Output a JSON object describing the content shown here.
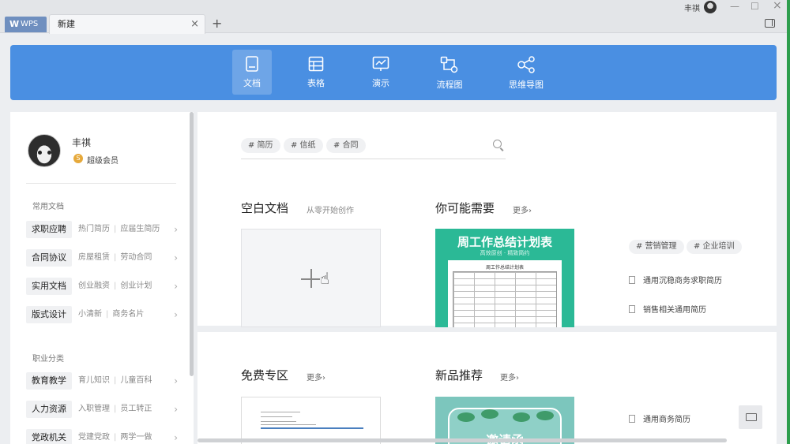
{
  "titlebar": {
    "app_tab": "WPS",
    "active_tab": "新建",
    "tab_close": "×",
    "add_tab": "+",
    "user_name": "丰祺",
    "minimize": "—",
    "maximize": "☐",
    "close": "×"
  },
  "categories": [
    {
      "label": "文档",
      "icon": "document-icon",
      "active": true
    },
    {
      "label": "表格",
      "icon": "spreadsheet-icon",
      "active": false
    },
    {
      "label": "演示",
      "icon": "presentation-icon",
      "active": false
    },
    {
      "label": "流程图",
      "icon": "flowchart-icon",
      "active": false
    },
    {
      "label": "思维导图",
      "icon": "mindmap-icon",
      "active": false
    }
  ],
  "sidebar": {
    "user_name": "丰祺",
    "vip_badge": "S",
    "vip_label": "超级会员",
    "section_common": "常用文档",
    "common_items": [
      {
        "tag": "求职应聘",
        "sub1": "热门简历",
        "sub2": "应届生简历"
      },
      {
        "tag": "合同协议",
        "sub1": "房屋租赁",
        "sub2": "劳动合同"
      },
      {
        "tag": "实用文档",
        "sub1": "创业融资",
        "sub2": "创业计划"
      },
      {
        "tag": "版式设计",
        "sub1": "小清新",
        "sub2": "商务名片"
      }
    ],
    "section_career": "职业分类",
    "career_items": [
      {
        "tag": "教育教学",
        "sub1": "育儿知识",
        "sub2": "儿童百科"
      },
      {
        "tag": "人力资源",
        "sub1": "入职管理",
        "sub2": "员工转正"
      },
      {
        "tag": "党政机关",
        "sub1": "党建党政",
        "sub2": "两学一做"
      }
    ],
    "separator": "|",
    "arrow": "›"
  },
  "search": {
    "tags": [
      "# 简历",
      "# 信纸",
      "# 合同"
    ]
  },
  "blank": {
    "title": "空白文档",
    "subtitle": "从零开始创作"
  },
  "recommend": {
    "title": "你可能需要",
    "more": "更多›",
    "card_title": "周工作总结计划表",
    "card_sub": "高效原创 · 精致简约",
    "card_doc_title": "周工作总结计划表",
    "tags": [
      "# 营销管理",
      "# 企业培训"
    ],
    "links": [
      "通用沉稳商务求职简历",
      "销售相关通用简历"
    ]
  },
  "free": {
    "title": "免费专区",
    "more": "更多›"
  },
  "new_items": {
    "title": "新品推荐",
    "more": "更多›",
    "card_text": "邀请函",
    "link": "通用商务简历"
  },
  "colors": {
    "accent": "#4a8fe2",
    "template_green": "#2bb996",
    "vip_gold": "#e6a93b"
  }
}
